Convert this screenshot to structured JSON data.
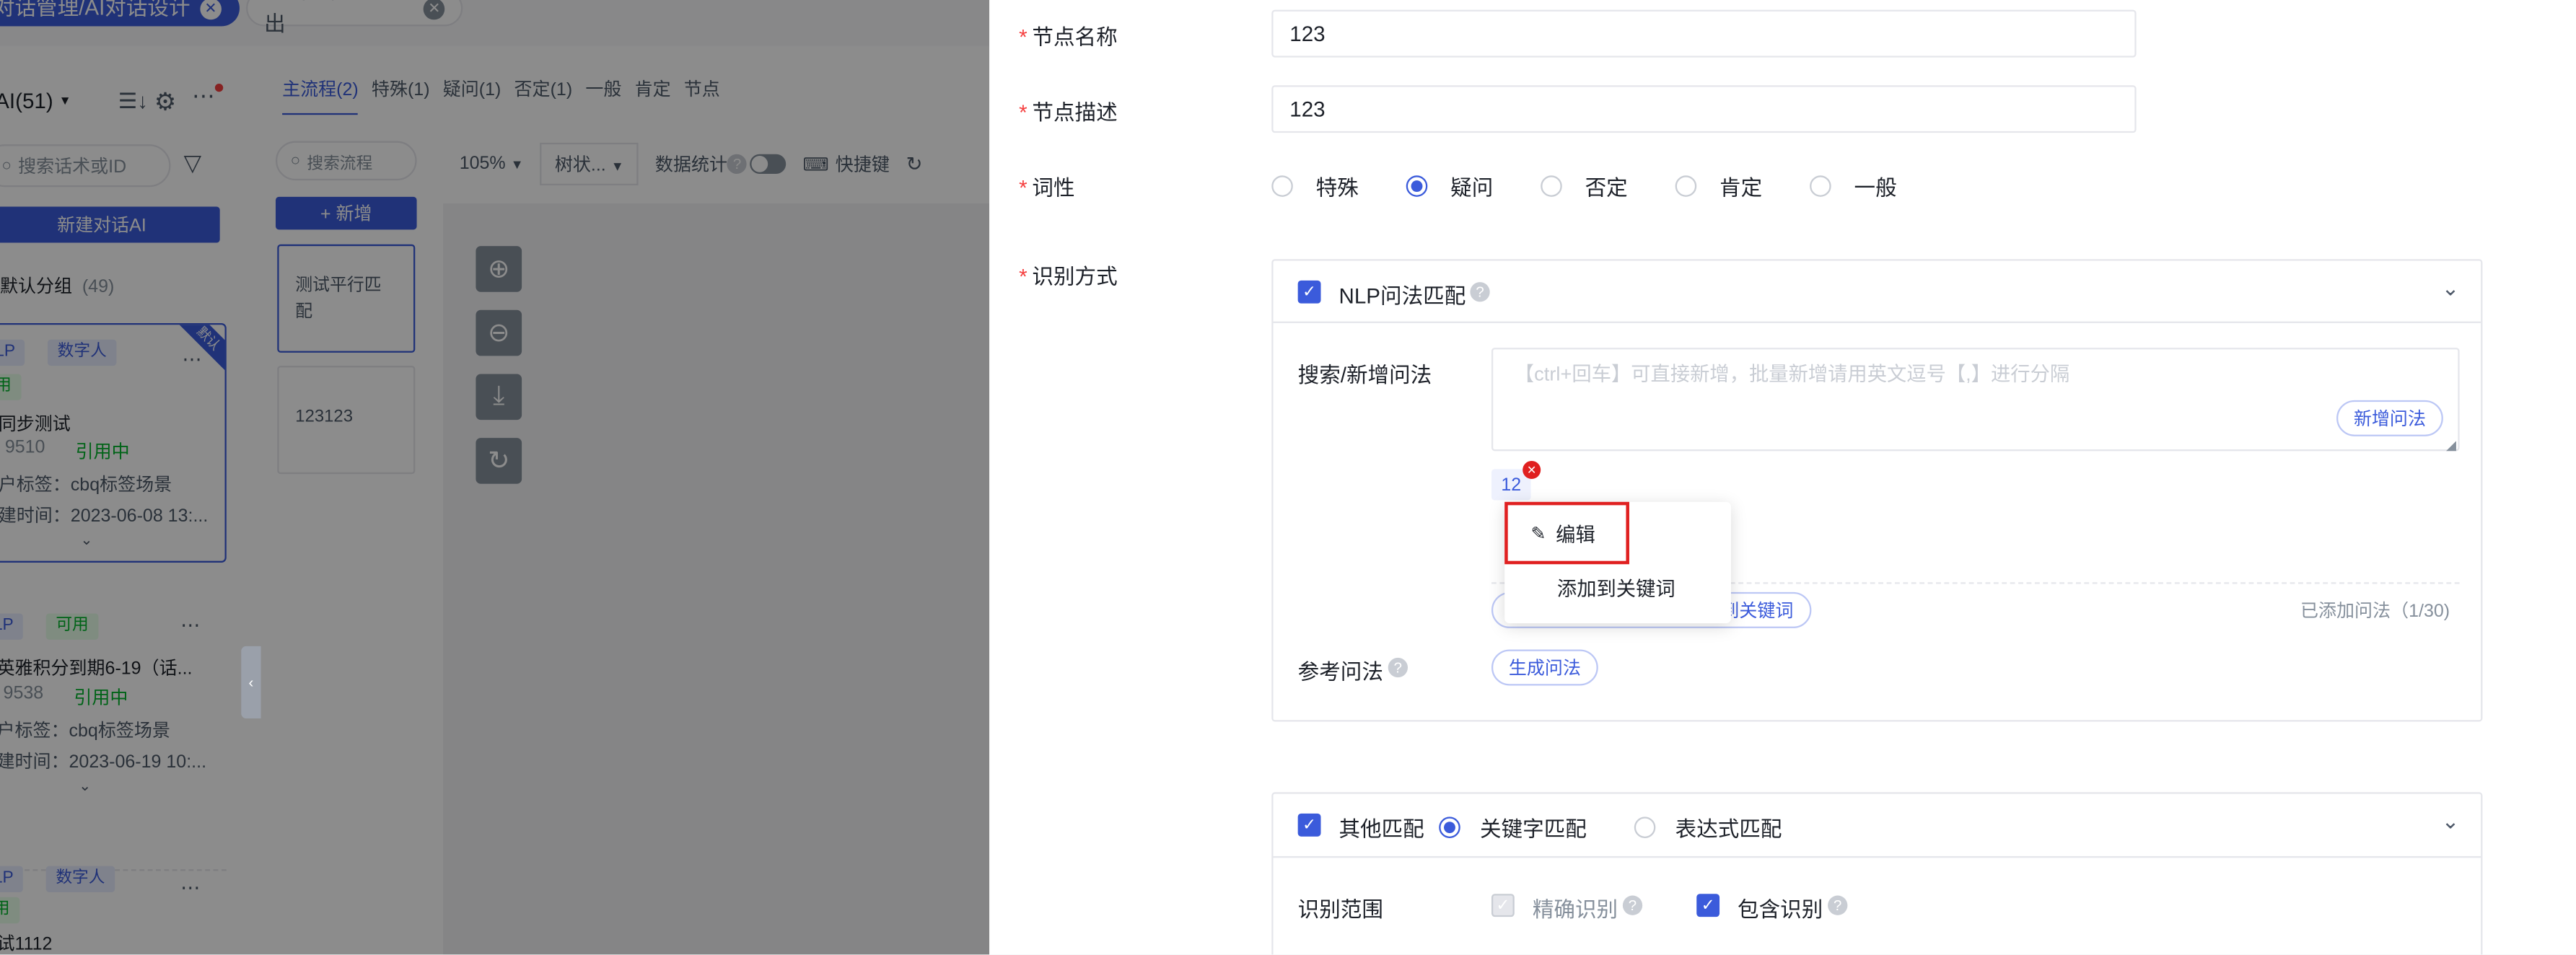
{
  "tabs": [
    {
      "label": "对话管理/AI对话设计",
      "close": "✕"
    },
    {
      "label": "呼叫中台/AI呼出",
      "close": "✕"
    }
  ],
  "left": {
    "title": "AI(51)",
    "search_placeholder": "搜索话术或ID",
    "new_button": "新建对话AI",
    "group_label": "默认分组",
    "group_count": "(49)",
    "cards": [
      {
        "tags": [
          "LP",
          "数字人"
        ],
        "status": "用",
        "title": "同步测试",
        "id": "9510",
        "ref": "引用中",
        "label_line": "户标签：cbq标签场景",
        "time_line": "建时间：2023-06-08 13:...",
        "ribbon": "默认"
      },
      {
        "tags": [
          "LP",
          "可用"
        ],
        "title": "英雅积分到期6-19（话...",
        "id": "9538",
        "ref": "引用中",
        "label_line": "户标签：cbq标签场景",
        "time_line": "建时间：2023-06-19 10:..."
      },
      {
        "tags": [
          "LP",
          "数字人"
        ],
        "status": "用",
        "title": "试1112"
      }
    ]
  },
  "main": {
    "tabs": [
      "主流程(2)",
      "特殊(1)",
      "疑问(1)",
      "否定(1)",
      "一般",
      "肯定",
      "节点"
    ],
    "search_placeholder": "搜索流程",
    "add_button": "+ 新增",
    "flows": [
      "测试平行匹配",
      "123123"
    ],
    "zoom": "105%",
    "layout": "树状...",
    "data_stats": "数据统计",
    "shortcut": "快捷键"
  },
  "drawer": {
    "node_name_label": "节点名称",
    "node_name_value": "123",
    "node_desc_label": "节点描述",
    "node_desc_value": "123",
    "pos_label": "词性",
    "pos_options": [
      "特殊",
      "疑问",
      "否定",
      "肯定",
      "一般"
    ],
    "pos_selected": "疑问",
    "recog_label": "识别方式",
    "nlp": {
      "title": "NLP问法匹配",
      "search_label": "搜索/新增问法",
      "textarea_placeholder": "【ctrl+回车】可直接新增，批量新增请用英文逗号【,】进行分隔",
      "add_button": "新增问法",
      "chip": "12",
      "hidden_button": "到关键词",
      "count": "已添加问法（1/30)",
      "ref_label": "参考问法",
      "gen_button": "生成问法"
    },
    "context_menu": [
      "编辑",
      "添加到关键词"
    ],
    "other": {
      "title": "其他匹配",
      "opt1": "关键字匹配",
      "opt2": "表达式匹配",
      "range_label": "识别范围",
      "exact": "精确识别",
      "contain": "包含识别"
    }
  },
  "colors": {
    "accent": "#3b5bdb",
    "required": "#f53f3f",
    "highlight": "#e02020"
  }
}
